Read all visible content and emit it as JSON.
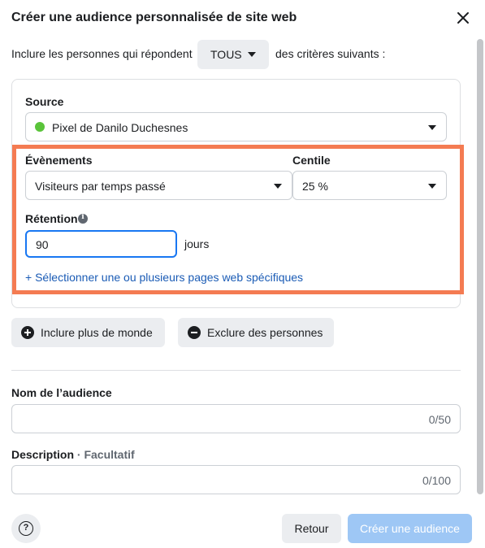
{
  "dialog": {
    "title": "Créer une audience personnalisée de site web",
    "close_icon": "close-icon"
  },
  "include_row": {
    "prefix": "Inclure les personnes qui répondent",
    "match_value": "TOUS",
    "suffix": "des critères suivants :"
  },
  "source": {
    "label": "Source",
    "value": "Pixel de Danilo Duchesnes",
    "status_color": "#5ac43a"
  },
  "events": {
    "label": "Évènements",
    "value": "Visiteurs par temps passé"
  },
  "percentile": {
    "label": "Centile",
    "value": "25 %"
  },
  "retention": {
    "label": "Rétention",
    "value": "90",
    "unit": "jours"
  },
  "select_pages_link": "+ Sélectionner une ou plusieurs pages web spécifiques",
  "actions": {
    "include_more": "Inclure plus de monde",
    "exclude": "Exclure des personnes"
  },
  "audience_name": {
    "label": "Nom de l’audience",
    "value": "",
    "counter": "0/50"
  },
  "description": {
    "label": "Description",
    "optional": " · Facultatif",
    "value": "",
    "counter": "0/100"
  },
  "footer": {
    "help": "?",
    "back": "Retour",
    "create": "Créer une audience"
  },
  "colors": {
    "highlight": "#f47b52",
    "primary_disabled": "#9ec7f5",
    "link": "#1a5bb5"
  }
}
